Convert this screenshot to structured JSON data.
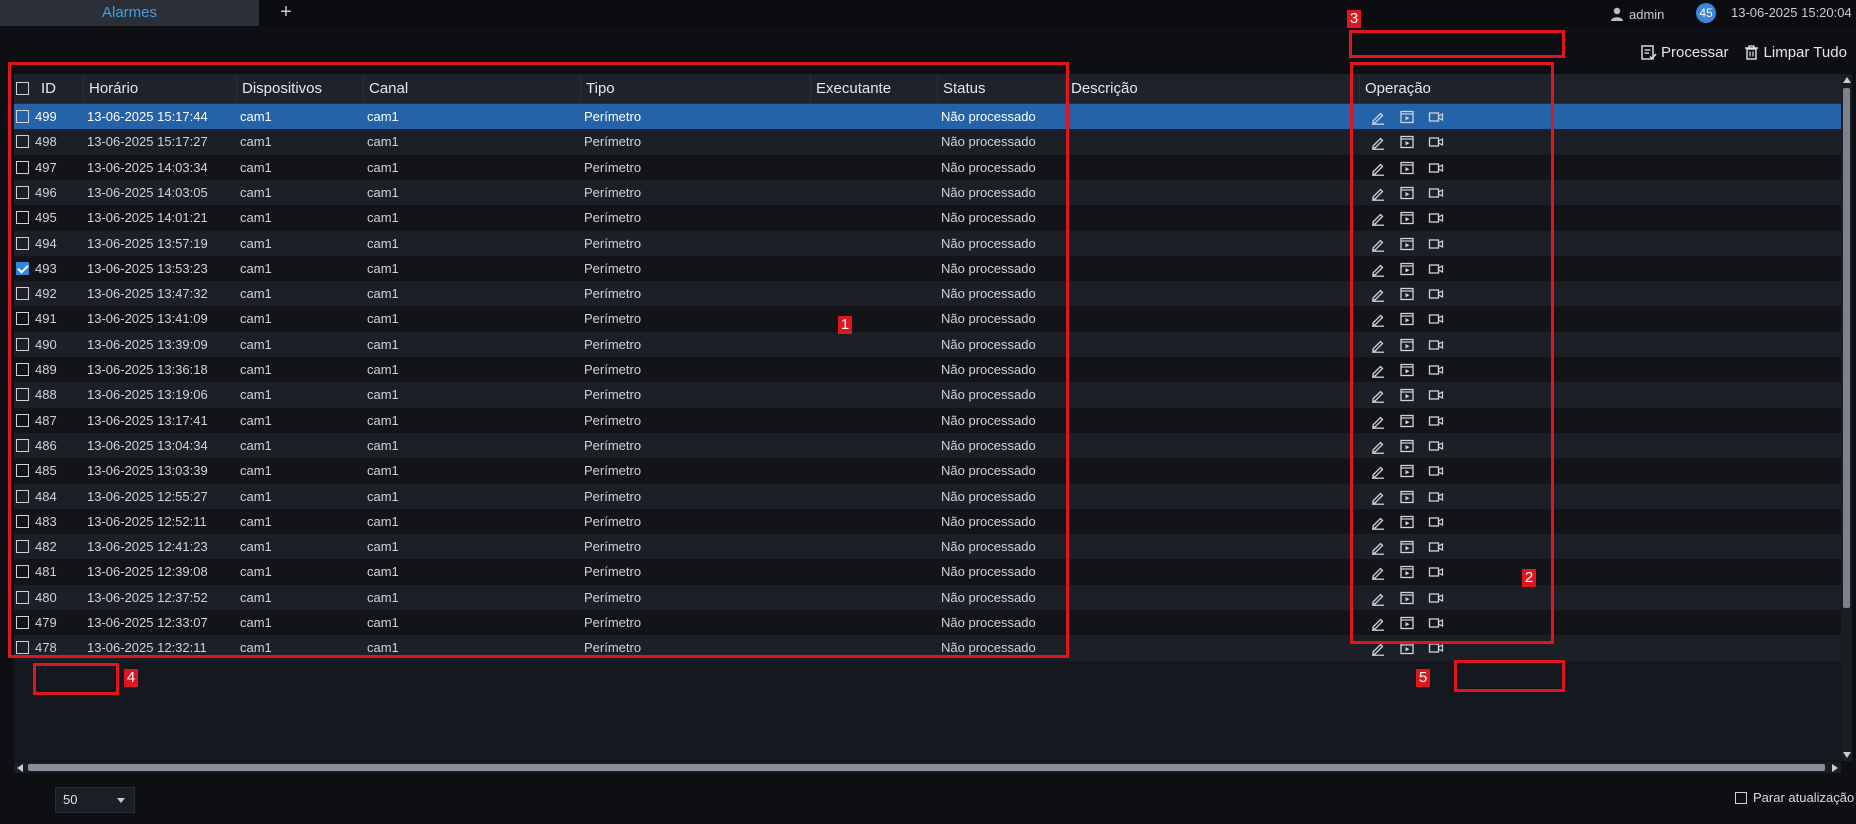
{
  "header": {
    "active_tab": "Alarmes",
    "add_tab": "+",
    "user": "admin",
    "badge": "45",
    "datetime": "13-06-2025 15:20:04"
  },
  "toolbar": {
    "process_label": "Processar",
    "clear_all_label": "Limpar Tudo"
  },
  "table": {
    "columns": [
      "ID",
      "Horário",
      "Dispositivos",
      "Canal",
      "Tipo",
      "Executante",
      "Status",
      "Descrição",
      "Operação"
    ],
    "rows": [
      {
        "id": "499",
        "time": "13-06-2025 15:17:44",
        "device": "cam1",
        "channel": "cam1",
        "type": "Perímetro",
        "executor": "",
        "status": "Não processado",
        "description": "",
        "checked": false
      },
      {
        "id": "498",
        "time": "13-06-2025 15:17:27",
        "device": "cam1",
        "channel": "cam1",
        "type": "Perímetro",
        "executor": "",
        "status": "Não processado",
        "description": "",
        "checked": false
      },
      {
        "id": "497",
        "time": "13-06-2025 14:03:34",
        "device": "cam1",
        "channel": "cam1",
        "type": "Perímetro",
        "executor": "",
        "status": "Não processado",
        "description": "",
        "checked": false
      },
      {
        "id": "496",
        "time": "13-06-2025 14:03:05",
        "device": "cam1",
        "channel": "cam1",
        "type": "Perímetro",
        "executor": "",
        "status": "Não processado",
        "description": "",
        "checked": false
      },
      {
        "id": "495",
        "time": "13-06-2025 14:01:21",
        "device": "cam1",
        "channel": "cam1",
        "type": "Perímetro",
        "executor": "",
        "status": "Não processado",
        "description": "",
        "checked": false
      },
      {
        "id": "494",
        "time": "13-06-2025 13:57:19",
        "device": "cam1",
        "channel": "cam1",
        "type": "Perímetro",
        "executor": "",
        "status": "Não processado",
        "description": "",
        "checked": false
      },
      {
        "id": "493",
        "time": "13-06-2025 13:53:23",
        "device": "cam1",
        "channel": "cam1",
        "type": "Perímetro",
        "executor": "",
        "status": "Não processado",
        "description": "",
        "checked": true
      },
      {
        "id": "492",
        "time": "13-06-2025 13:47:32",
        "device": "cam1",
        "channel": "cam1",
        "type": "Perímetro",
        "executor": "",
        "status": "Não processado",
        "description": "",
        "checked": false
      },
      {
        "id": "491",
        "time": "13-06-2025 13:41:09",
        "device": "cam1",
        "channel": "cam1",
        "type": "Perímetro",
        "executor": "",
        "status": "Não processado",
        "description": "",
        "checked": false
      },
      {
        "id": "490",
        "time": "13-06-2025 13:39:09",
        "device": "cam1",
        "channel": "cam1",
        "type": "Perímetro",
        "executor": "",
        "status": "Não processado",
        "description": "",
        "checked": false
      },
      {
        "id": "489",
        "time": "13-06-2025 13:36:18",
        "device": "cam1",
        "channel": "cam1",
        "type": "Perímetro",
        "executor": "",
        "status": "Não processado",
        "description": "",
        "checked": false
      },
      {
        "id": "488",
        "time": "13-06-2025 13:19:06",
        "device": "cam1",
        "channel": "cam1",
        "type": "Perímetro",
        "executor": "",
        "status": "Não processado",
        "description": "",
        "checked": false
      },
      {
        "id": "487",
        "time": "13-06-2025 13:17:41",
        "device": "cam1",
        "channel": "cam1",
        "type": "Perímetro",
        "executor": "",
        "status": "Não processado",
        "description": "",
        "checked": false
      },
      {
        "id": "486",
        "time": "13-06-2025 13:04:34",
        "device": "cam1",
        "channel": "cam1",
        "type": "Perímetro",
        "executor": "",
        "status": "Não processado",
        "description": "",
        "checked": false
      },
      {
        "id": "485",
        "time": "13-06-2025 13:03:39",
        "device": "cam1",
        "channel": "cam1",
        "type": "Perímetro",
        "executor": "",
        "status": "Não processado",
        "description": "",
        "checked": false
      },
      {
        "id": "484",
        "time": "13-06-2025 12:55:27",
        "device": "cam1",
        "channel": "cam1",
        "type": "Perímetro",
        "executor": "",
        "status": "Não processado",
        "description": "",
        "checked": false
      },
      {
        "id": "483",
        "time": "13-06-2025 12:52:11",
        "device": "cam1",
        "channel": "cam1",
        "type": "Perímetro",
        "executor": "",
        "status": "Não processado",
        "description": "",
        "checked": false
      },
      {
        "id": "482",
        "time": "13-06-2025 12:41:23",
        "device": "cam1",
        "channel": "cam1",
        "type": "Perímetro",
        "executor": "",
        "status": "Não processado",
        "description": "",
        "checked": false
      },
      {
        "id": "481",
        "time": "13-06-2025 12:39:08",
        "device": "cam1",
        "channel": "cam1",
        "type": "Perímetro",
        "executor": "",
        "status": "Não processado",
        "description": "",
        "checked": false
      },
      {
        "id": "480",
        "time": "13-06-2025 12:37:52",
        "device": "cam1",
        "channel": "cam1",
        "type": "Perímetro",
        "executor": "",
        "status": "Não processado",
        "description": "",
        "checked": false
      },
      {
        "id": "479",
        "time": "13-06-2025 12:33:07",
        "device": "cam1",
        "channel": "cam1",
        "type": "Perímetro",
        "executor": "",
        "status": "Não processado",
        "description": "",
        "checked": false
      },
      {
        "id": "478",
        "time": "13-06-2025 12:32:11",
        "device": "cam1",
        "channel": "cam1",
        "type": "Perímetro",
        "executor": "",
        "status": "Não processado",
        "description": "",
        "checked": false
      }
    ],
    "operation_icons": [
      "edit-icon",
      "playback-icon",
      "video-icon"
    ]
  },
  "footer": {
    "page_size": "50",
    "stop_refresh_label": "Parar atualização"
  },
  "annotations": [
    "1",
    "2",
    "3",
    "4",
    "5"
  ],
  "colors": {
    "accent": "#3fa0e0",
    "selected_row": "#2463a8",
    "annotation": "#e0161e",
    "checkbox_checked": "#2f86e0"
  }
}
